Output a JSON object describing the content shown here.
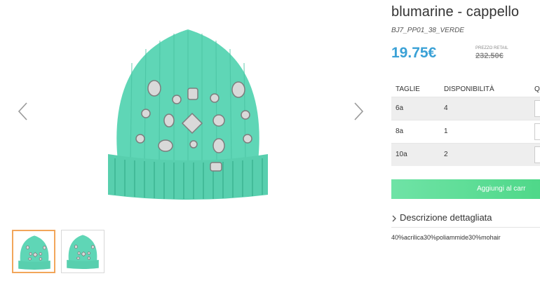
{
  "product": {
    "title": "blumarine - cappello",
    "sku": "BJ7_PP01_38_VERDE",
    "price": "19.75€",
    "retail_label": "PREZZO RETAIL",
    "retail_price": "232.50€"
  },
  "gallery": {
    "prev_icon": "chevron-left-icon",
    "next_icon": "chevron-right-icon",
    "hat_color": "#5fd6b6",
    "active_thumb_border": "#f2a65a"
  },
  "sizes": {
    "headers": {
      "size": "TAGLIE",
      "availability": "DISPONIBILITÀ",
      "quantity": "Q"
    },
    "rows": [
      {
        "size": "6a",
        "availability": "4"
      },
      {
        "size": "8a",
        "availability": "1"
      },
      {
        "size": "10a",
        "availability": "2"
      }
    ]
  },
  "cart": {
    "label": "Aggiungi al carr",
    "color": "#5ddc96"
  },
  "description": {
    "toggle_label": "Descrizione dettagliata",
    "text": "40%acrilica30%poliammide30%mohair"
  },
  "colors": {
    "price": "#3aa1d6"
  }
}
